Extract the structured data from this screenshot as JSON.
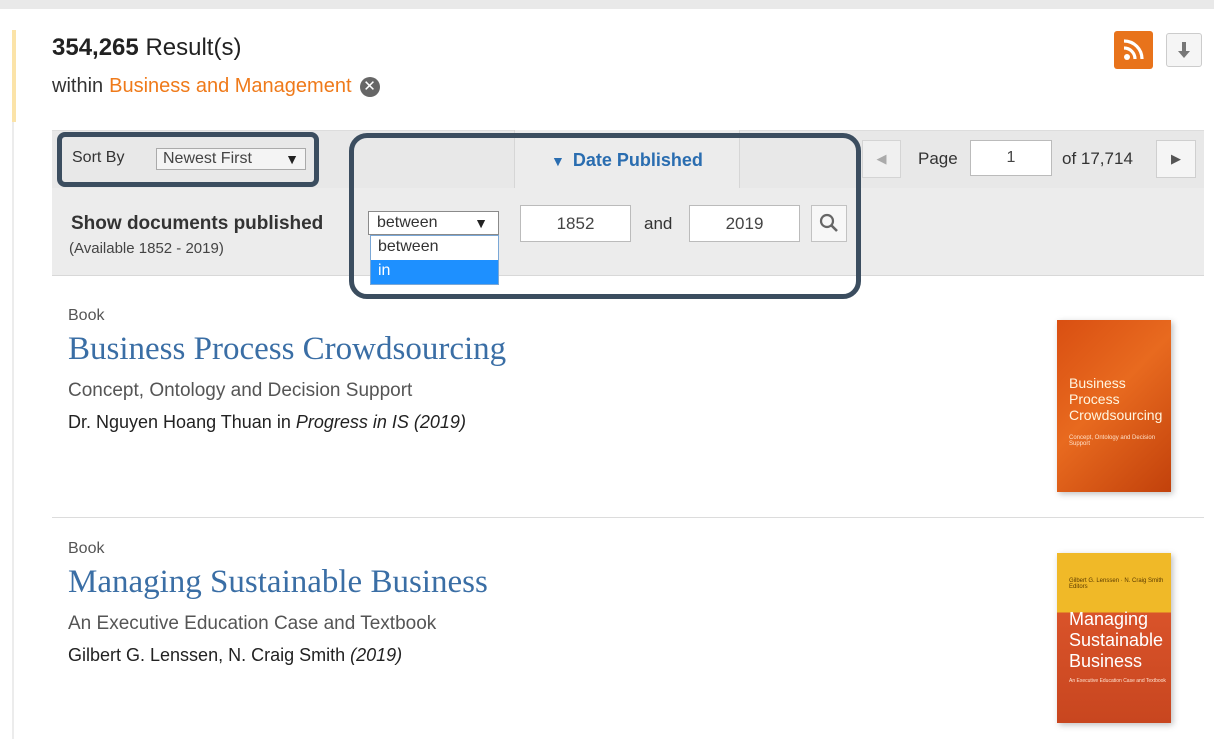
{
  "results_header": {
    "count": "354,265",
    "count_suffix": "Result(s)",
    "within_prefix": "within",
    "category": "Business and Management",
    "clear_icon": "x-circle-icon"
  },
  "actions": {
    "rss_icon": "rss-icon",
    "download_icon": "download-icon",
    "rss_color": "#e8731b"
  },
  "sort": {
    "label": "Sort By",
    "selected": "Newest First",
    "arrow": "▼"
  },
  "date_tab": {
    "arrow": "▼",
    "label": "Date Published"
  },
  "pagination": {
    "prev": "◀",
    "page_label": "Page",
    "current": "1",
    "of_label": "of 17,714",
    "next": "▶"
  },
  "date_filter": {
    "label": "Show documents published",
    "available": "(Available 1852 - 2019)",
    "mode_selected": "between",
    "mode_arrow": "▼",
    "options": [
      "between",
      "in"
    ],
    "highlighted_option": "in",
    "from_year": "1852",
    "and_label": "and",
    "to_year": "2019",
    "search_icon": "search-icon"
  },
  "results": [
    {
      "type": "Book",
      "title": "Business Process Crowdsourcing",
      "subtitle": "Concept, Ontology and Decision Support",
      "authors": "Dr. Nguyen Hoang Thuan",
      "in_word": "in",
      "source": "Progress in IS (2019)",
      "cover_title": "Business Process Crowdsourcing",
      "cover_subtitle": "Concept, Ontology and Decision Support"
    },
    {
      "type": "Book",
      "title": "Managing Sustainable Business",
      "subtitle": "An Executive Education Case and Textbook",
      "authors": "Gilbert G. Lenssen, N. Craig Smith",
      "year": "(2019)",
      "cover_authors": "Gilbert G. Lenssen · N. Craig Smith Editors",
      "cover_title": "Managing Sustainable Business",
      "cover_subtitle": "An Executive Education Case and Textbook"
    }
  ],
  "colors": {
    "accent_orange": "#ef7a1a",
    "link_blue": "#3a6ea5",
    "highlight_box": "#3b4d5f",
    "dropdown_selected": "#1e90ff"
  }
}
